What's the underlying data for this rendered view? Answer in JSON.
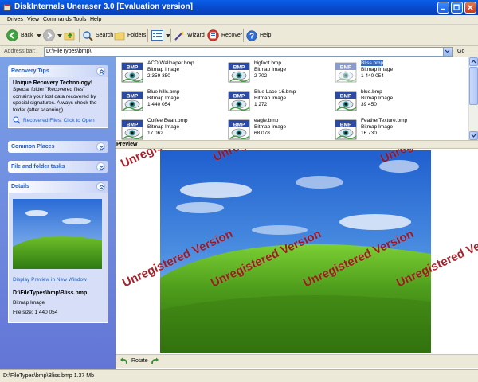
{
  "window": {
    "title": "DiskInternals Uneraser 3.0 [Evaluation version]"
  },
  "menu": [
    "Drives",
    "View",
    "Commands",
    "Tools",
    "Help"
  ],
  "toolbar": {
    "back_label": "Back",
    "search_label": "Search",
    "folders_label": "Folders",
    "wizard_label": "Wizard",
    "recover_label": "Recover",
    "help_label": "Help"
  },
  "address": {
    "label": "Address bar:",
    "value": "D:\\FileTypes\\bmp\\",
    "go_label": "Go"
  },
  "sidebar": {
    "recovery_tips": {
      "title": "Recovery Tips",
      "heading": "Unique Recovery Technology!",
      "text": "Special folder \"Recovered files\" contains your lost data recovered by special signatures. Always check the folder (after scanning)",
      "link": "Recovered Files. Click to Open"
    },
    "common_places_title": "Common Places",
    "file_tasks_title": "File and folder tasks",
    "details": {
      "title": "Details",
      "preview_link": "Display Preview in New Window",
      "path": "D:\\FileTypes\\bmp\\Bliss.bmp",
      "type": "Bitmap Image",
      "size": "File size: 1 440 054"
    }
  },
  "files": [
    {
      "name": "ACD Wallpaper.bmp",
      "type": "Bitmap Image",
      "size": "2 359 350"
    },
    {
      "name": "bigfoot.bmp",
      "type": "Bitmap Image",
      "size": "2 702"
    },
    {
      "name": "Bliss.bmp",
      "type": "Bitmap Image",
      "size": "1 440 054",
      "selected": true
    },
    {
      "name": "Blue hills.bmp",
      "type": "Bitmap Image",
      "size": "1 440 054"
    },
    {
      "name": "Blue Lace 16.bmp",
      "type": "Bitmap Image",
      "size": "1 272"
    },
    {
      "name": "blue.bmp",
      "type": "Bitmap Image",
      "size": "39 450"
    },
    {
      "name": "Coffee Bean.bmp",
      "type": "Bitmap Image",
      "size": "17 062"
    },
    {
      "name": "eagle.bmp",
      "type": "Bitmap Image",
      "size": "68 078"
    },
    {
      "name": "FeatherTexture.bmp",
      "type": "Bitmap Image",
      "size": "16 730"
    }
  ],
  "preview": {
    "title": "Preview",
    "watermark": "Unregistered Version",
    "rotate_label": "Rotate"
  },
  "status": {
    "text": "D:\\FileTypes\\bmp\\Bliss.bmp 1.37 Mb"
  },
  "colors": {
    "titlebar": "#0a5ee8",
    "taskpane": "#7ba2e7",
    "selection": "#316ac5",
    "watermark": "#a0111b"
  }
}
